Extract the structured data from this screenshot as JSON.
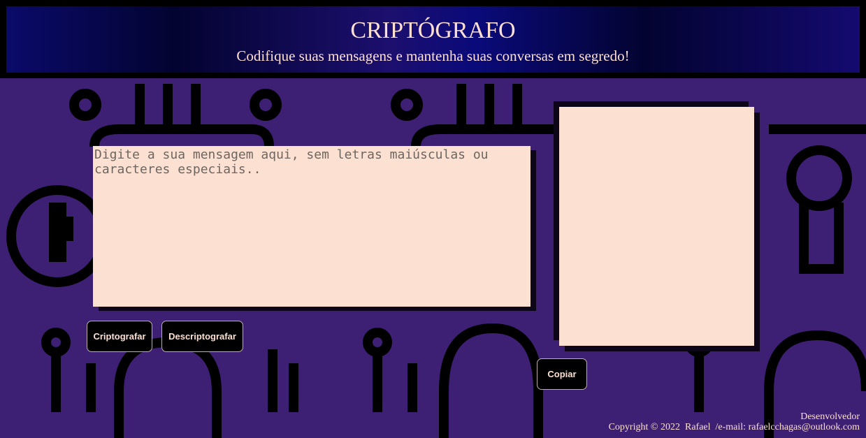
{
  "header": {
    "title": "CRIPTÓGRAFO",
    "subtitle": "Codifique suas mensagens e mantenha suas conversas em segredo!"
  },
  "input": {
    "placeholder": "Digite a sua mensagem aqui, sem letras maiúsculas ou caracteres especiais..",
    "value": ""
  },
  "output": {
    "value": ""
  },
  "buttons": {
    "encrypt": "Criptografar",
    "decrypt": "Descriptografar",
    "copy": "Copiar"
  },
  "footer": {
    "role": "Desenvolvedor",
    "copyright": "Copyright © 2022  Rafael  /e-mail: rafaelcchagas@outlook.com"
  },
  "colors": {
    "background": "#3d1f73",
    "text_area": "#fce0d2",
    "button": "#000000",
    "text": "#fde0d2"
  }
}
